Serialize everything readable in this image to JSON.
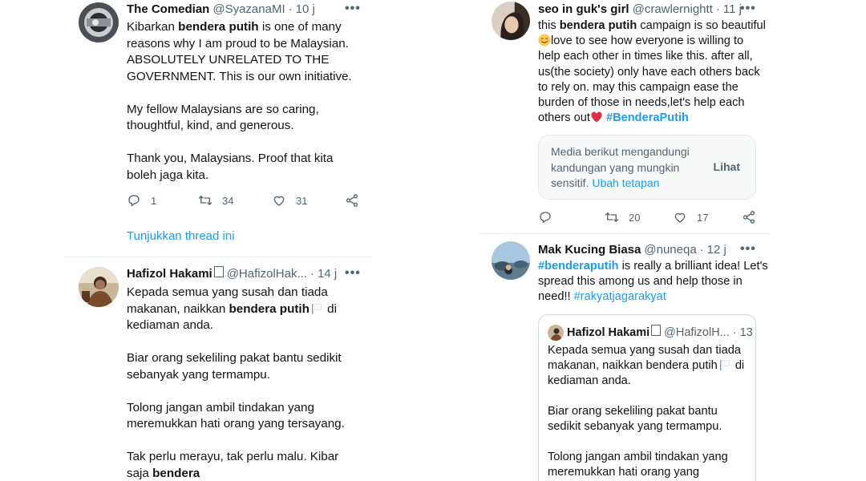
{
  "left": {
    "tweet1": {
      "name": "The Comedian",
      "handle": "@SyazanaMI",
      "dot": "·",
      "time": "10 j",
      "more": "•••",
      "lines": [
        [
          "Kibarkan ",
          "bendera putih",
          " is one of many"
        ],
        "reasons why I am proud to be Malaysian.",
        "ABSOLUTELY UNRELATED TO THE",
        "GOVERNMENT. This is our own initiative.",
        "My fellow Malaysians are so caring,",
        "thoughtful, kind, and generous.",
        "Thank you, Malaysians. Proof that kita",
        "boleh jaga kita."
      ],
      "replies": "1",
      "retweets": "34",
      "likes": "31",
      "show_thread": "Tunjukkan thread ini"
    },
    "tweet2": {
      "name": "Hafizol Hakami",
      "badge": "",
      "handle": "@HafizolHak...",
      "dot": "·",
      "time": "14 j",
      "more": "•••",
      "l1": "Kepada semua yang susah dan tiada",
      "l2a": "makanan, naikkan ",
      "l2b": "bendera putih",
      "l2c": " di",
      "l3": "kediaman anda.",
      "l4": "Biar orang sekeliling pakat bantu sedikit",
      "l5": "sebanyak yang termampu.",
      "l6": "Tolong jangan ambil tindakan yang",
      "l7": "meremukkan hati orang yang tersayang.",
      "l8": "Tak perlu merayu, tak perlu  malu. Kibar",
      "l9a": "saja ",
      "l9b": "bendera"
    }
  },
  "right": {
    "tweet1": {
      "name": "seo in guk's girl",
      "handle": "@crawlernightt",
      "dot": "·",
      "time": "11 j",
      "more": "•••",
      "l1a": "this ",
      "l1b": "bendera putih",
      "l1c": " campaign is so beautiful",
      "l2": "love to see how everyone is willing to",
      "l3": "help each other in times like this. after all,",
      "l4": "us(the society) only have each others back",
      "l5": "to rely on. may this campaign ease the",
      "l6": "burden of those in needs,let's help each",
      "l7": "others out",
      "hashtag": "#BenderaPutih",
      "sensitive_l1": "Media berikut mengandungi",
      "sensitive_l2": "kandungan yang mungkin",
      "sensitive_l3": "sensitif.",
      "sensitive_link": "Ubah tetapan",
      "sensitive_button": "Lihat",
      "retweets": "20",
      "likes": "17"
    },
    "tweet2": {
      "name": "Mak Kucing Biasa",
      "handle": "@nuneqa",
      "dot": "·",
      "time": "12 j",
      "more": "•••",
      "l1a": "#benderaputih",
      "l1b": " is really a brilliant idea! Let's",
      "l2": "spread this among us and help those in",
      "l3a": "need!! ",
      "l3b": "#rakyatjagarakyat",
      "quote": {
        "name": "Hafizol Hakami",
        "handle": "@HafizolH...",
        "dot": "·",
        "time": "13 j",
        "q1": "Kepada semua yang susah dan tiada",
        "q2a": "makanan, naikkan bendera putih",
        "q2b": " di",
        "q3": "kediaman anda.",
        "q4": "Biar orang sekeliling pakat bantu",
        "q5": "sedikit sebanyak yang termampu.",
        "q6": "Tolong jangan ambil tindakan yang",
        "q7": "meremukkan hati orang yang"
      }
    }
  },
  "colors": {
    "link": "#1d9bf0",
    "secondary": "#536471",
    "text": "#0f1419",
    "heart": "#e0245e"
  },
  "icons": [
    "reply-icon",
    "retweet-icon",
    "like-icon",
    "share-icon",
    "more-icon",
    "flag-icon",
    "smile-emoji-icon",
    "red-heart-emoji-icon"
  ]
}
